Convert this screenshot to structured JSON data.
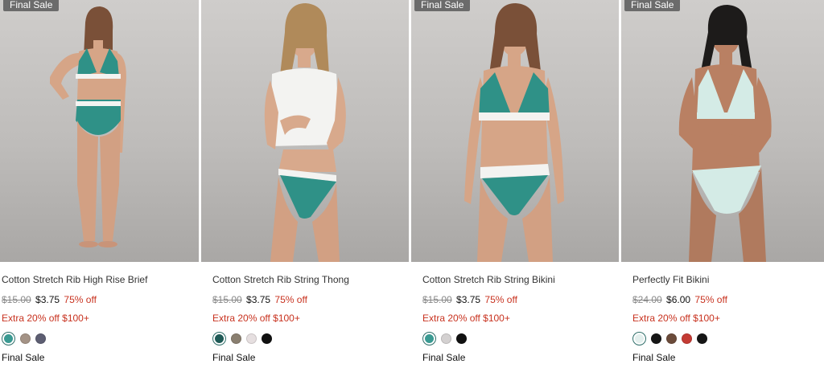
{
  "products": [
    {
      "badge": "Final Sale",
      "title": "Cotton Stretch Rib High Rise Brief",
      "price_original": "$15.00",
      "price_sale": "$3.75",
      "discount": "75% off",
      "promo": "Extra 20% off $100+",
      "final_label": "Final Sale",
      "swatches": [
        {
          "color": "#3a9a92",
          "selected": true
        },
        {
          "color": "#a49386",
          "selected": false
        },
        {
          "color": "#5d5e72",
          "selected": false
        }
      ]
    },
    {
      "badge": "",
      "title": "Cotton Stretch Rib String Thong",
      "price_original": "$15.00",
      "price_sale": "$3.75",
      "discount": "75% off",
      "promo": "Extra 20% off $100+",
      "final_label": "Final Sale",
      "swatches": [
        {
          "color": "#1f5a56",
          "selected": true
        },
        {
          "color": "#8a7f70",
          "selected": false
        },
        {
          "color": "#e6dfe0",
          "selected": false
        },
        {
          "color": "#111111",
          "selected": false
        }
      ]
    },
    {
      "badge": "Final Sale",
      "title": "Cotton Stretch Rib String Bikini",
      "price_original": "$15.00",
      "price_sale": "$3.75",
      "discount": "75% off",
      "promo": "Extra 20% off $100+",
      "final_label": "Final Sale",
      "swatches": [
        {
          "color": "#3a9a92",
          "selected": true
        },
        {
          "color": "#d4d1d1",
          "selected": false
        },
        {
          "color": "#111111",
          "selected": false
        }
      ]
    },
    {
      "badge": "Final Sale",
      "title": "Perfectly Fit Bikini",
      "price_original": "$24.00",
      "price_sale": "$6.00",
      "discount": "75% off",
      "promo": "Extra 20% off $100+",
      "final_label": "Final Sale",
      "swatches": [
        {
          "color": "#e3efed",
          "selected": true
        },
        {
          "color": "#161616",
          "selected": false
        },
        {
          "color": "#6b4b3a",
          "selected": false
        },
        {
          "color": "#c43b34",
          "selected": false
        },
        {
          "color": "#161616",
          "selected": false
        }
      ]
    }
  ],
  "colors": {
    "teal_garment": "#2f9187",
    "white_top": "#f3f3f1",
    "mint_garment": "#d4ebe6",
    "skin": "#d6a587"
  }
}
